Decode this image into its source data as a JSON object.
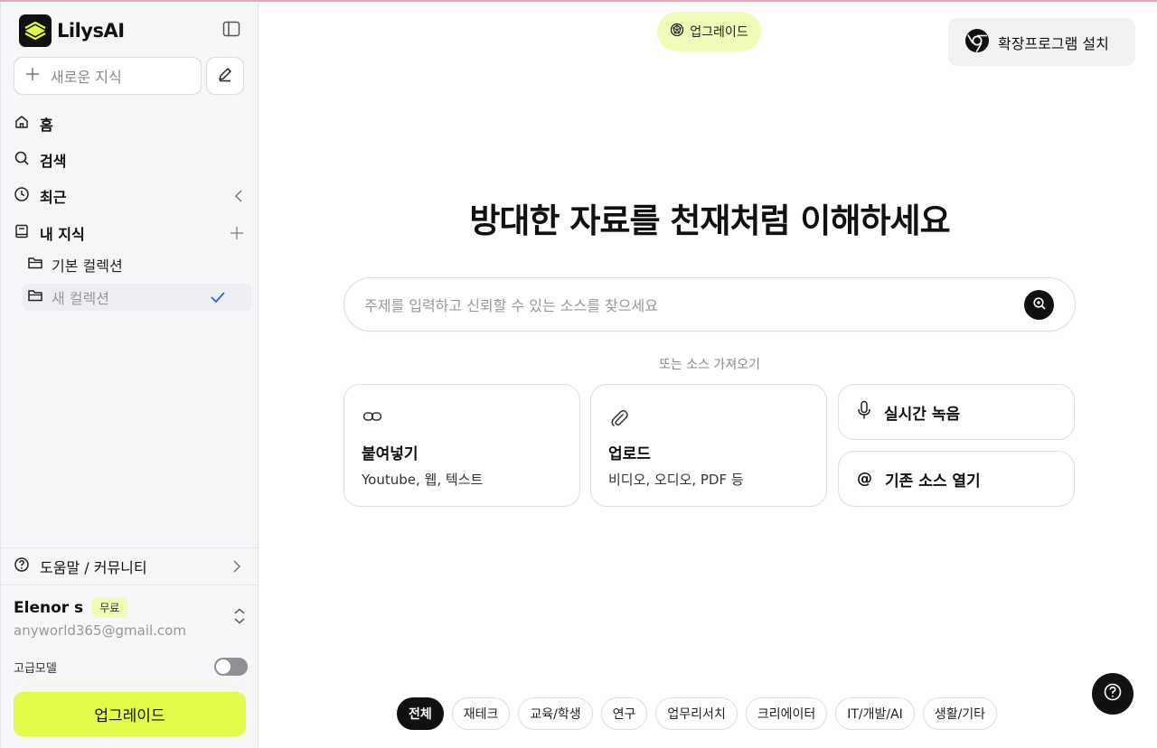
{
  "brand": {
    "name": "LilysAI"
  },
  "sidebar": {
    "new_knowledge_label": "새로운 지식",
    "nav": [
      {
        "label": "홈",
        "icon": "home-icon"
      },
      {
        "label": "검색",
        "icon": "search-icon"
      },
      {
        "label": "최근",
        "icon": "clock-icon"
      },
      {
        "label": "내 지식",
        "icon": "book-icon"
      }
    ],
    "collections": [
      {
        "label": "기본 컬렉션",
        "icon": "folder-icon"
      },
      {
        "label": "새 컬렉션",
        "icon": "folder-icon",
        "active": true
      }
    ],
    "help_label": "도움말 / 커뮤니티",
    "user": {
      "name": "Elenor s",
      "plan": "무료",
      "email": "anyworld365@gmail.com"
    },
    "advanced_model_label": "고급모델",
    "advanced_model_enabled": false,
    "upgrade_label": "업그레이드"
  },
  "header": {
    "upgrade_pill_label": "업그레이드",
    "extension_label": "확장프로그램 설치"
  },
  "main": {
    "headline": "방대한 자료를 천재처럼 이해하세요",
    "search_placeholder": "주제를 입력하고 신뢰할 수 있는 소스를 찾으세요",
    "or_import": "또는 소스 가져오기",
    "cards": {
      "paste": {
        "title": "붙여넣기",
        "sub": "Youtube, 웹, 텍스트"
      },
      "upload": {
        "title": "업로드",
        "sub": "비디오, 오디오, PDF 등"
      },
      "record": {
        "title": "실시간 녹음"
      },
      "open_existing": {
        "title": "기존 소스 열기"
      }
    },
    "categories": [
      "전체",
      "재테크",
      "교육/학생",
      "연구",
      "업무리서치",
      "크리에이터",
      "IT/개발/AI",
      "생활/기타"
    ],
    "active_category": "전체"
  },
  "colors": {
    "accent": "#e3fb4a",
    "accent_soft": "#eefcb8",
    "dark": "#111111"
  }
}
